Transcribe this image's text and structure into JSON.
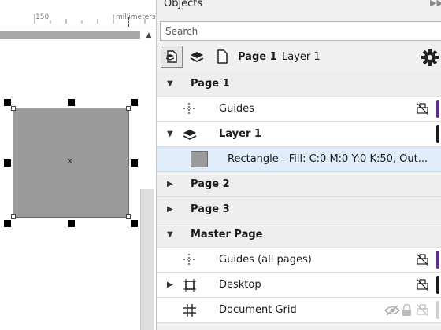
{
  "ruler": {
    "tick_label": "150",
    "unit": "millimeters"
  },
  "objects_panel": {
    "title": "Objects",
    "search_placeholder": "Search",
    "current_page": "Page 1",
    "current_layer": "Layer 1"
  },
  "tree": {
    "page1": "Page 1",
    "guides": "Guides",
    "layer1": "Layer 1",
    "rectangle": "Rectangle - Fill: C:0 M:0 Y:0 K:50, Out...",
    "page2": "Page 2",
    "page3": "Page 3",
    "master_page": "Master Page",
    "guides_all": "Guides (all pages)",
    "desktop": "Desktop",
    "document_grid": "Document Grid"
  },
  "colors": {
    "guides_layer": "#5b2d8e",
    "layer1": "#1a1a1a",
    "guides_all_layer": "#5b2d8e",
    "desktop_layer": "#1a1a1a",
    "rectangle_fill": "#9a9a9a",
    "selection_highlight": "#dfecfa"
  }
}
